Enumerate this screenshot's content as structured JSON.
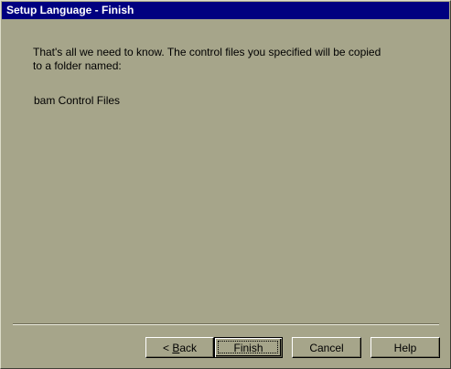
{
  "window": {
    "title": "Setup Language - Finish"
  },
  "message": {
    "line1": "That's all we need to know.  The control files you specified will be copied",
    "line2": "to a folder named:",
    "folder_name": "bam Control Files"
  },
  "buttons": {
    "back_prefix": "< ",
    "back_mnemonic": "B",
    "back_rest": "ack",
    "finish_label": "Finish",
    "cancel_label": "Cancel",
    "help_label": "Help"
  },
  "colors": {
    "titlebar": "#000080",
    "face": "#a6a58a"
  }
}
